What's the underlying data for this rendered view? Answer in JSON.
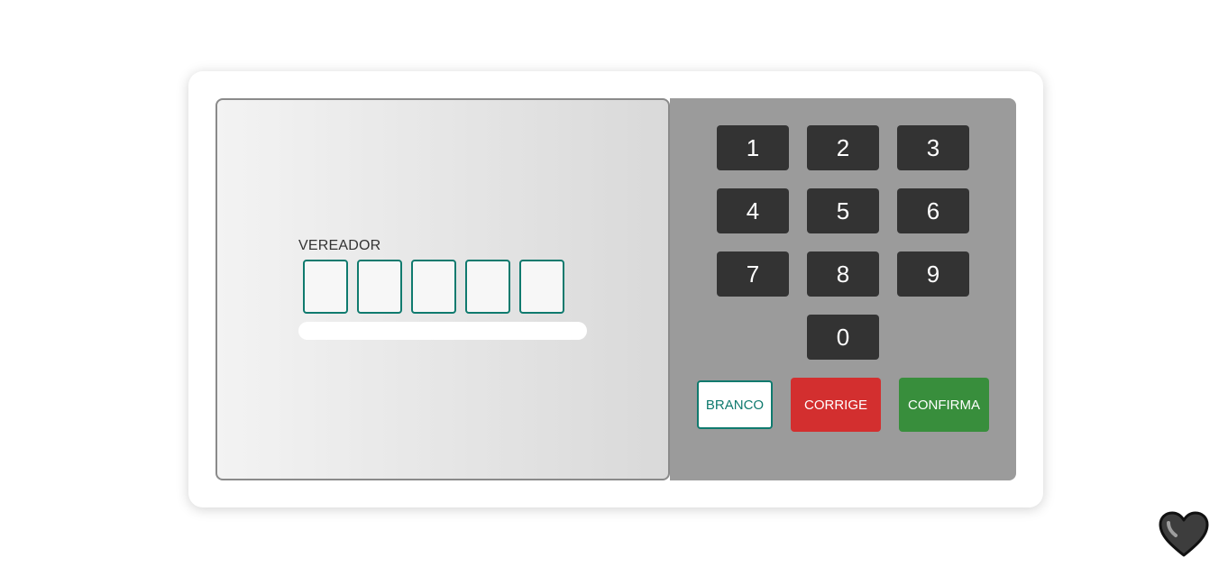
{
  "screen": {
    "office_label": "VEREADOR",
    "digits": [
      "",
      "",
      "",
      "",
      ""
    ],
    "info_text": ""
  },
  "keypad": {
    "keys": [
      "1",
      "2",
      "3",
      "4",
      "5",
      "6",
      "7",
      "8",
      "9",
      "0"
    ],
    "actions": {
      "branco": "BRANCO",
      "corrige": "CORRIGE",
      "confirma": "CONFIRMA"
    }
  },
  "colors": {
    "accent": "#0f7a6e",
    "corrige": "#d32f2f",
    "confirma": "#388e3c",
    "key": "#333333",
    "keypad_panel": "#9b9b9b"
  },
  "icons": {
    "floating": "heart-icon"
  }
}
